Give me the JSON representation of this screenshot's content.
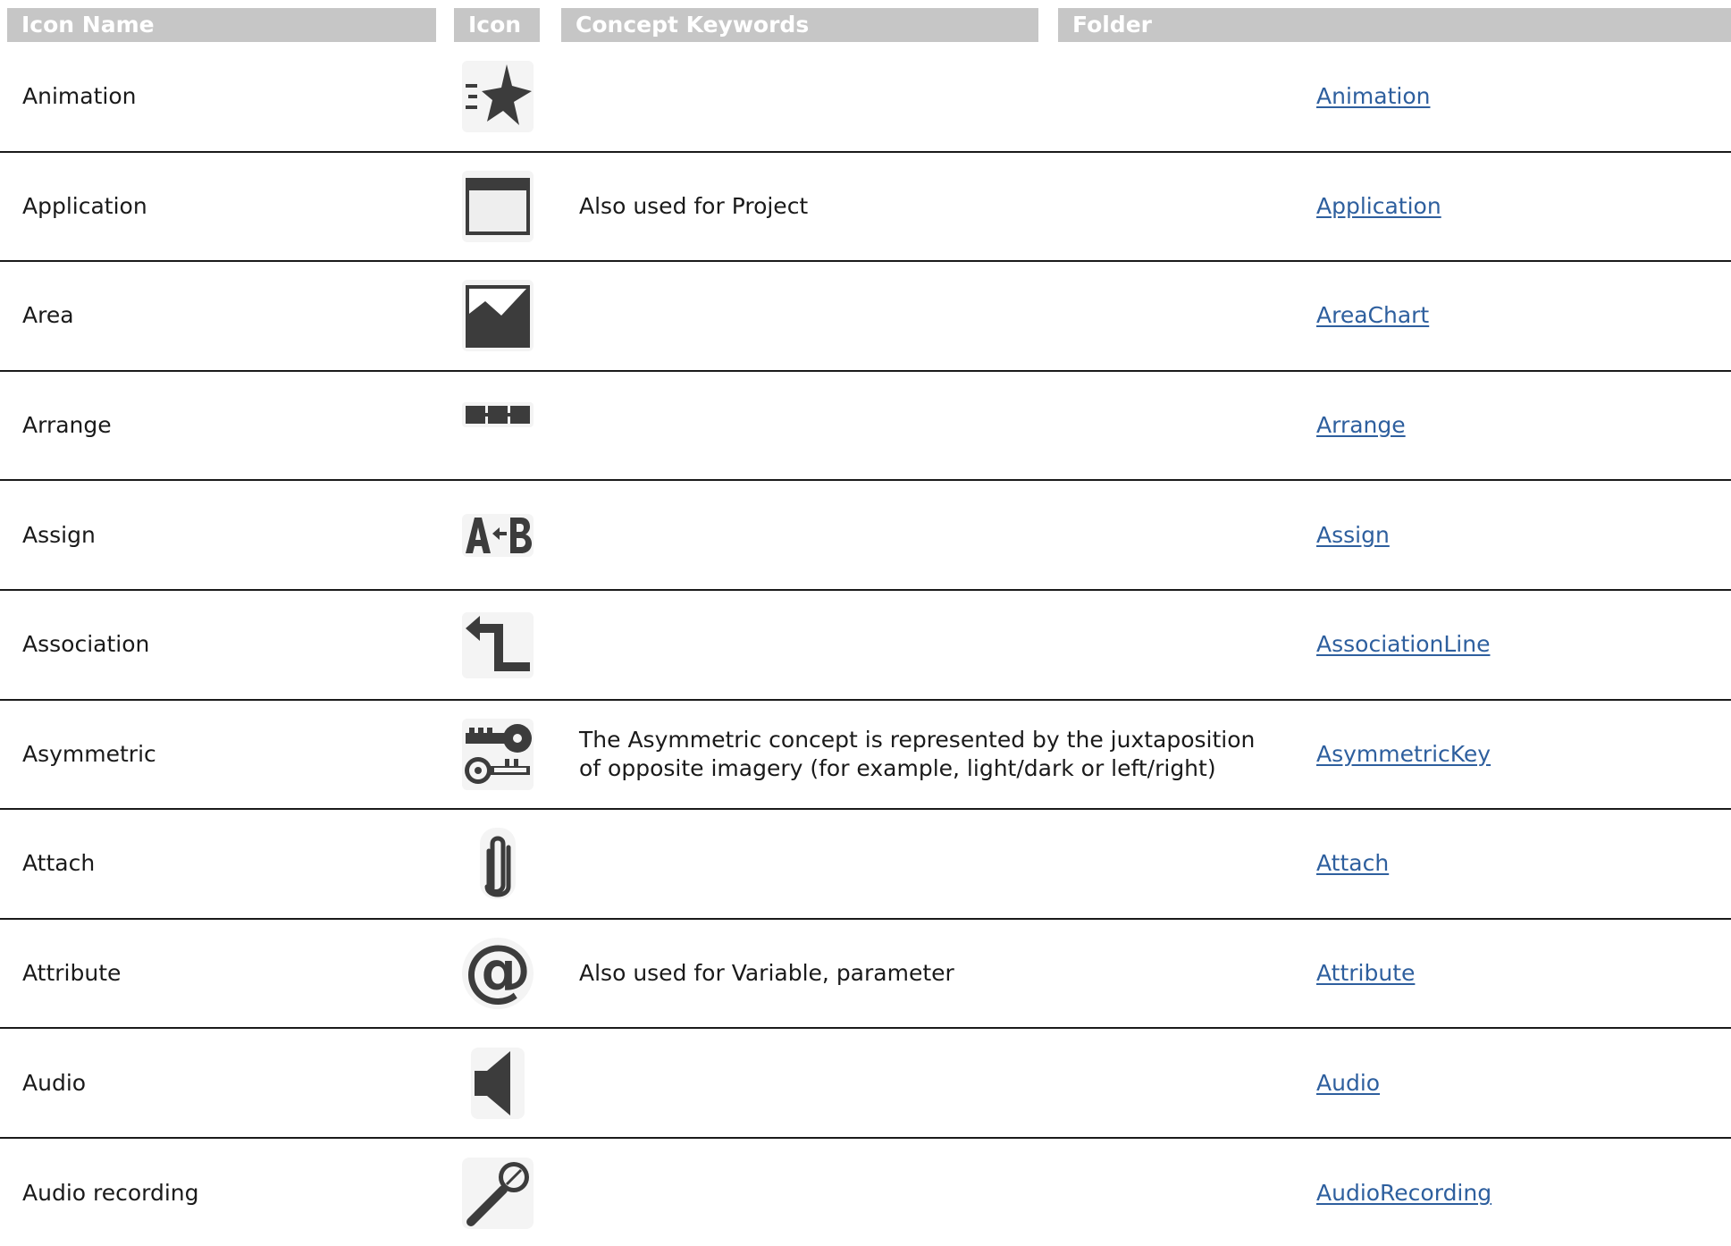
{
  "header": {
    "name": "Icon Name",
    "icon": "Icon",
    "concept": "Concept Keywords",
    "folder": "Folder"
  },
  "colors": {
    "header_bg": "#c6c6c6",
    "header_text": "#ffffff",
    "icon_fill": "#3c3c3c",
    "link": "#2e5f9e",
    "rule": "#1a1a1a"
  },
  "rows": [
    {
      "name": "Animation",
      "icon": "animation-icon",
      "concept": "",
      "folder": "Animation"
    },
    {
      "name": "Application",
      "icon": "application-icon",
      "concept": "Also used for Project",
      "folder": "Application"
    },
    {
      "name": "Area",
      "icon": "area-chart-icon",
      "concept": "",
      "folder": "AreaChart"
    },
    {
      "name": "Arrange",
      "icon": "arrange-icon",
      "concept": "",
      "folder": "Arrange"
    },
    {
      "name": "Assign",
      "icon": "assign-icon",
      "concept": "",
      "folder": "Assign"
    },
    {
      "name": "Association",
      "icon": "association-line-icon",
      "concept": "",
      "folder": "AssociationLine"
    },
    {
      "name": "Asymmetric",
      "icon": "asymmetric-key-icon",
      "concept": "The Asymmetric concept is represented by the juxtaposition of opposite imagery (for example, light/dark or left/right)",
      "folder": "AsymmetricKey"
    },
    {
      "name": "Attach",
      "icon": "paperclip-icon",
      "concept": "",
      "folder": "Attach"
    },
    {
      "name": "Attribute",
      "icon": "at-sign-icon",
      "concept": "Also used for Variable, parameter",
      "folder": "Attribute"
    },
    {
      "name": "Audio",
      "icon": "speaker-icon",
      "concept": "",
      "folder": "Audio"
    },
    {
      "name": "Audio recording",
      "icon": "microphone-icon",
      "concept": "",
      "folder": "AudioRecording"
    }
  ]
}
